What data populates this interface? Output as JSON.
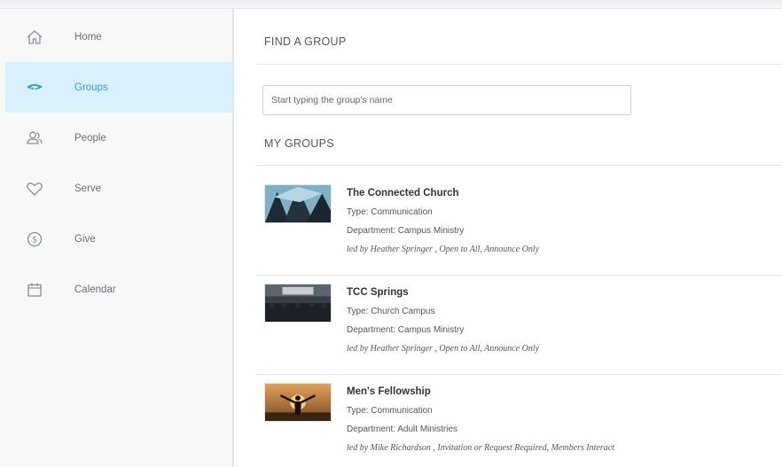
{
  "sidebar": {
    "items": [
      {
        "label": "Home",
        "icon": "home-icon",
        "active": false
      },
      {
        "label": "Groups",
        "icon": "groups-icon",
        "active": true
      },
      {
        "label": "People",
        "icon": "people-icon",
        "active": false
      },
      {
        "label": "Serve",
        "icon": "heart-icon",
        "active": false
      },
      {
        "label": "Give",
        "icon": "dollar-coin-icon",
        "active": false
      },
      {
        "label": "Calendar",
        "icon": "calendar-icon",
        "active": false
      }
    ]
  },
  "main": {
    "find_title": "FIND A GROUP",
    "search_placeholder": "Start typing the group's name",
    "my_groups_title": "MY GROUPS",
    "groups": [
      {
        "name": "The Connected Church",
        "type": "Type: Communication",
        "department": "Department: Campus Ministry",
        "leader": "led by Heather Springer , Open to All, Announce Only",
        "thumb": "tent-image"
      },
      {
        "name": "TCC Springs",
        "type": "Type: Church Campus",
        "department": "Department: Campus Ministry",
        "leader": "led by Heather Springer , Open to All, Announce Only",
        "thumb": "stage-image"
      },
      {
        "name": "Men's Fellowship",
        "type": "Type: Communication",
        "department": "Department: Adult Ministries",
        "leader": "led by Mike Richardson , Invitation or Request Required, Members Interact",
        "thumb": "sunset-image"
      }
    ]
  },
  "colors": {
    "accent": "#2e9fd6",
    "active_bg": "#d8f1fc",
    "sidebar_bg": "#f8f8f9"
  }
}
